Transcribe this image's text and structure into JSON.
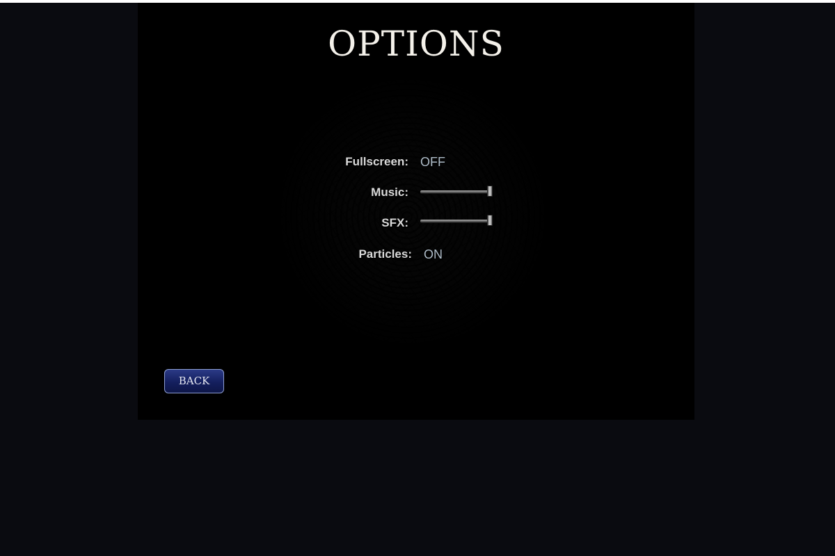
{
  "screen": {
    "title": "OPTIONS"
  },
  "options": {
    "fullscreen": {
      "label": "Fullscreen:",
      "value": "OFF"
    },
    "music": {
      "label": "Music:",
      "level": 1.0
    },
    "sfx": {
      "label": "SFX:",
      "level": 1.0
    },
    "particles": {
      "label": "Particles:",
      "value": "ON"
    }
  },
  "back_button": {
    "label": "BACK"
  },
  "colors": {
    "page_background": "#0a0b10",
    "canvas_background": "#000000",
    "title": "#f4f1ea",
    "label": "#d9d9d9",
    "value": "#aebcc8",
    "button_fill": "#1a2565",
    "button_border": "#8fa0d4"
  }
}
